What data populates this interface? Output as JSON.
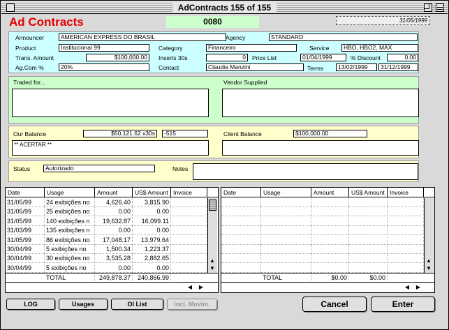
{
  "window": {
    "title": "AdContracts 155 of 155"
  },
  "app": {
    "name": "Ad Contracts",
    "record_no": "0080",
    "date": "31/05/1999"
  },
  "contract": {
    "announcer_label": "Announcer",
    "announcer": "AMERICAN EXPRESS DO BRASIL",
    "agency_label": "Agency",
    "agency": "STANDARD",
    "product_label": "Product",
    "product": "Institucional 99",
    "category_label": "Category",
    "category": "Financeiro",
    "service_label": "Service",
    "service": "HBO, HBO2, MAX",
    "trans_amount_label": "Trans. Amount",
    "trans_amount": "$100,000.00",
    "inserts_label": "Inserts 30s",
    "inserts": "0",
    "price_list_label": "Price List",
    "price_list": "01/04/1999",
    "discount_label": "% Discount",
    "discount": "0.00",
    "agcom_label": "Ag.Com %",
    "agcom": "20%",
    "contact_label": "Contact",
    "contact": "Claudia Manzini",
    "terms_label": "Terms",
    "terms_from": "13/02/1999",
    "terms_to": "31/12/1999"
  },
  "traded": {
    "traded_label": "Traded for...",
    "vendor_label": "Vendor Supplied"
  },
  "balance": {
    "our_label": "Our Balance",
    "our_value": "$50,121.62 x30s",
    "our_diff": "-515",
    "our_note": "** ACERTAR **",
    "client_label": "Client Balance",
    "client_value": "$100,000.00"
  },
  "status": {
    "status_label": "Status",
    "status_value": "Autorizado",
    "notes_label": "Notes"
  },
  "left_table": {
    "headers": [
      "Date",
      "Usage",
      "Amount",
      "US$ Amount",
      "Invoice"
    ],
    "rows": [
      [
        "31/05/99",
        "24 exibições no",
        "4,626.40",
        "3,815.90",
        ""
      ],
      [
        "31/05/99",
        "25 exibições no",
        "0.00",
        "0.00",
        ""
      ],
      [
        "31/05/99",
        "140 exibições n",
        "19,632.87",
        "16,099.11",
        ""
      ],
      [
        "31/03/99",
        "135 exibições n",
        "0.00",
        "0.00",
        ""
      ],
      [
        "31/05/99",
        "86 exibições no",
        "17,048.17",
        "13,979.64",
        ""
      ],
      [
        "30/04/99",
        "5 exibições no",
        "1,500.34",
        "1,223.37",
        ""
      ],
      [
        "30/04/99",
        "30 exibições no",
        "3,535.28",
        "2,882.65",
        ""
      ],
      [
        "30/04/99",
        "5 exibições no",
        "0.00",
        "0.00",
        ""
      ]
    ],
    "total_label": "TOTAL",
    "total_amount": "249,878.37",
    "total_usd": "240,866.99"
  },
  "right_table": {
    "headers": [
      "Date",
      "Usage",
      "Amount",
      "US$ Amount",
      "Invoice"
    ],
    "total_label": "TOTAL",
    "total_amount": "$0.00",
    "total_usd": "$0.00"
  },
  "buttons": {
    "log": "LOG",
    "usages": "Usages",
    "oi_list": "OI List",
    "incl_movim": "Incl. Movim.",
    "cancel": "Cancel",
    "enter": "Enter"
  }
}
